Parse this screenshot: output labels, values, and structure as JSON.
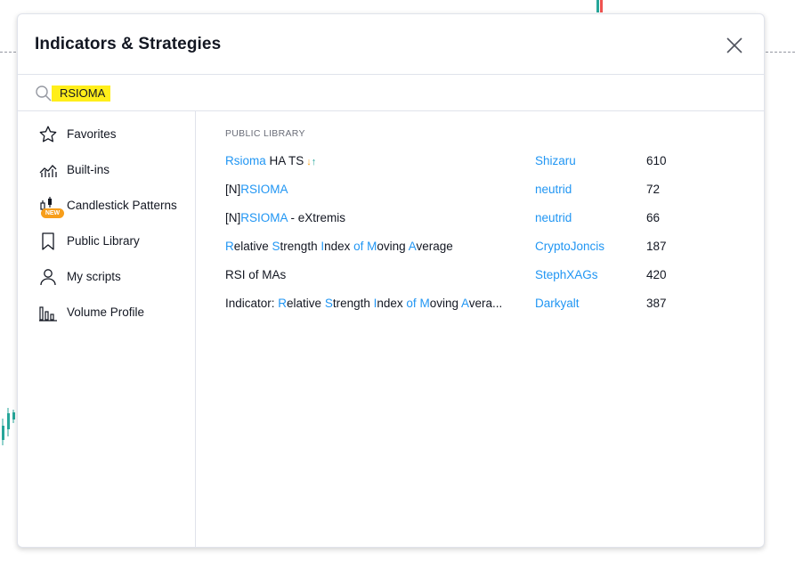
{
  "dialog": {
    "title": "Indicators & Strategies",
    "close_icon": "close-icon"
  },
  "search": {
    "value": "RSIOMA",
    "icon": "search-icon"
  },
  "sidebar": {
    "items": [
      {
        "label": "Favorites",
        "icon": "star-icon"
      },
      {
        "label": "Built-ins",
        "icon": "chart-icon"
      },
      {
        "label": "Candlestick Patterns",
        "icon": "candlestick-icon",
        "badge": "NEW"
      },
      {
        "label": "Public Library",
        "icon": "bookmark-icon"
      },
      {
        "label": "My scripts",
        "icon": "user-icon"
      },
      {
        "label": "Volume Profile",
        "icon": "volume-profile-icon"
      }
    ]
  },
  "main": {
    "section_label": "PUBLIC LIBRARY",
    "rows": [
      {
        "name": "Rsioma HA TS",
        "author": "Shizaru",
        "likes": "610"
      },
      {
        "name": "[N]RSIOMA",
        "author": "neutrid",
        "likes": "72"
      },
      {
        "name": "[N]RSIOMA - eXtremis",
        "author": "neutrid",
        "likes": "66"
      },
      {
        "name": "Relative Strength Index of Moving Average",
        "author": "CryptoJoncis",
        "likes": "187"
      },
      {
        "name": "RSI of MAs",
        "author": "StephXAGs",
        "likes": "420"
      },
      {
        "name": "Indicator: Relative Strength Index of Moving Avera...",
        "author": "Darkyalt",
        "likes": "387"
      }
    ],
    "strategy_arrows": "↓↑"
  },
  "colors": {
    "accent": "#2196f3",
    "highlight": "#ffee1a",
    "badge": "#f79e1b",
    "text": "#131722",
    "muted": "#6a6d78",
    "border": "#e0e3eb"
  }
}
